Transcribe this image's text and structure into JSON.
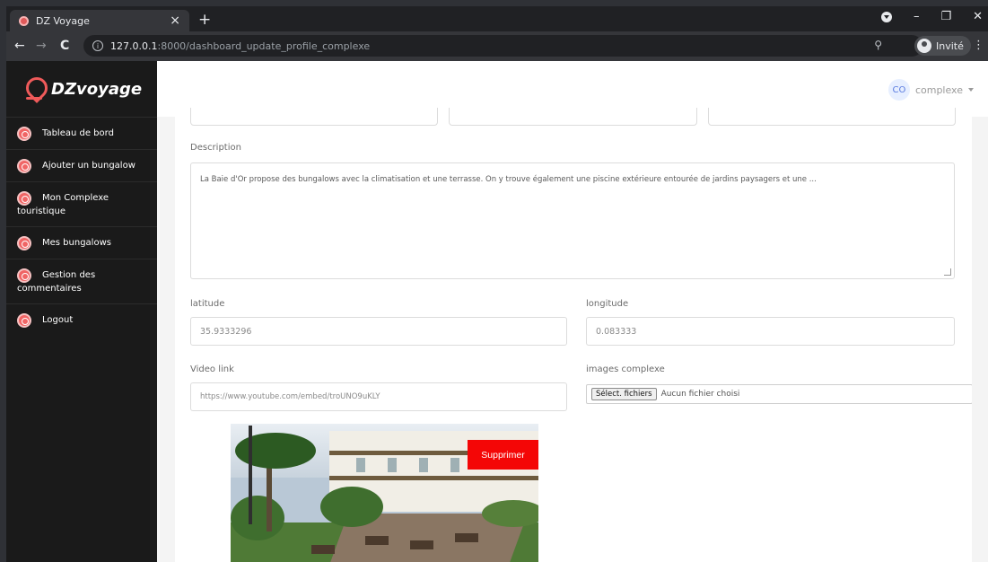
{
  "browser": {
    "tab_title": "DZ Voyage",
    "tab_close": "×",
    "new_tab": "+",
    "url_host": "127.0.0.1",
    "url_path": ":8000/dashboard_update_profile_complexe",
    "profile_label": "Invité",
    "win_min": "–",
    "win_restore": "❐",
    "win_close": "✕",
    "back": "←",
    "forward": "→",
    "reload": "C",
    "kebab": "⋮",
    "zoom": "⚲",
    "info": "i"
  },
  "sidebar": {
    "brand": "DZvoyage",
    "items": [
      {
        "label": "Tableau de bord"
      },
      {
        "label": "Ajouter un bungalow"
      },
      {
        "label_line1": "Mon Complexe",
        "label_line2": "touristique"
      },
      {
        "label": "Mes bungalows"
      },
      {
        "label_line1": "Gestion des",
        "label_line2": "commentaires"
      },
      {
        "label": "Logout"
      }
    ]
  },
  "header": {
    "avatar_initials": "CO",
    "username": "complexe"
  },
  "form": {
    "description_label": "Description",
    "description_value": "La Baie d'Or propose des bungalows avec la climatisation et une terrasse. On y trouve également une piscine extérieure entourée de jardins paysagers et une ...",
    "latitude_label": "latitude",
    "latitude_value": "35.9333296",
    "longitude_label": "longitude",
    "longitude_value": "0.083333",
    "video_label": "Video link",
    "video_value": "https://www.youtube.com/embed/troUNO9uKLY",
    "images_label": "images complexe",
    "file_button": "Sélect. fichiers",
    "file_status": "Aucun fichier choisi",
    "delete_button": "Supprimer"
  }
}
